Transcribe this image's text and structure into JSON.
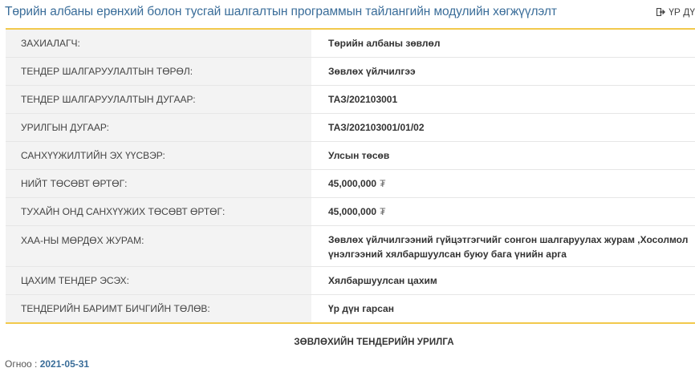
{
  "page": {
    "title": "Төрийн албаны ерөнхий болон тусгай шалгалтын программын тайлангийн модулийн хөгжүүлэлт",
    "result_link": "ҮР ДҮ",
    "result_icon": "sign-out-icon"
  },
  "table": {
    "rows": [
      {
        "label": "ЗАХИАЛАГЧ:",
        "value": "Төрийн албаны зөвлөл"
      },
      {
        "label": "ТЕНДЕР ШАЛГАРУУЛАЛТЫН ТӨРӨЛ:",
        "value": "Зөвлөх үйлчилгээ"
      },
      {
        "label": "ТЕНДЕР ШАЛГАРУУЛАЛТЫН ДУГААР:",
        "value": "ТАЗ/202103001"
      },
      {
        "label": "УРИЛГЫН ДУГААР:",
        "value": "ТАЗ/202103001/01/02"
      },
      {
        "label": "САНХҮҮЖИЛТИЙН ЭХ ҮҮСВЭР:",
        "value": "Улсын төсөв"
      },
      {
        "label": "НИЙТ ТӨСӨВТ ӨРТӨГ:",
        "value": "45,000,000",
        "currency": "₮"
      },
      {
        "label": "ТУХАЙН ОНД САНХҮҮЖИХ ТӨСӨВТ ӨРТӨГ:",
        "value": "45,000,000",
        "currency": "₮"
      },
      {
        "label": "ХАА-НЫ МӨРДӨХ ЖУРАМ:",
        "value": "Зөвлөх үйлчилгээний гүйцэтгэгчийг сонгон шалгаруулах журам ,Хосолмол үнэлгээний хялбаршуулсан буюу бага үнийн арга"
      },
      {
        "label": "ЦАХИМ ТЕНДЕР ЭСЭХ:",
        "value": "Хялбаршуулсан цахим"
      },
      {
        "label": "ТЕНДЕРИЙН БАРИМТ БИЧГИЙН ТӨЛӨВ:",
        "value": "Үр дүн гарсан"
      }
    ]
  },
  "section": {
    "title": "ЗӨВЛӨХИЙН ТЕНДЕРИЙН УРИЛГА"
  },
  "date": {
    "label": "Огноо :",
    "value": "2021-05-31"
  },
  "colors": {
    "title_blue": "#3a6d99",
    "border_yellow": "#f2c94c",
    "label_bg": "#f3f3f3"
  }
}
